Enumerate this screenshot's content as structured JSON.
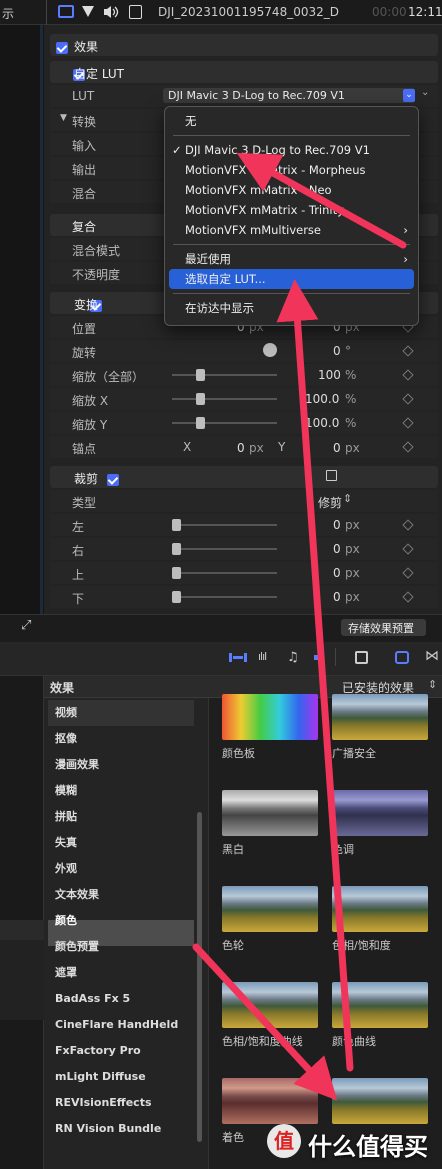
{
  "topbar": {
    "left_label": "示",
    "filename": "DJI_20231001195748_0032_D",
    "timecode_dim": "00:00",
    "timecode": "12:11"
  },
  "effects_header": "效果",
  "custom_lut": {
    "title": "自定 LUT",
    "lut_label": "LUT",
    "lut_value": "DJI Mavic 3 D-Log to Rec.709 V1",
    "convert_label": "转换",
    "input_label": "输入",
    "output_label": "输出",
    "mix_label": "混合"
  },
  "composite": {
    "title": "复合",
    "blend_mode": "混合模式",
    "opacity": "不透明度"
  },
  "transform": {
    "title": "变换",
    "rows": [
      {
        "label": "位置",
        "x": "0",
        "xunit": "px",
        "y": "0",
        "yunit": "px"
      },
      {
        "label": "旋转",
        "value": "0",
        "unit": "°"
      },
      {
        "label": "缩放（全部）",
        "value": "100",
        "unit": "%"
      },
      {
        "label": "缩放 X",
        "value": "100.0",
        "unit": "%"
      },
      {
        "label": "缩放 Y",
        "value": "100.0",
        "unit": "%"
      },
      {
        "label": "锚点",
        "xl": "X",
        "x": "0",
        "xunit": "px",
        "yl": "Y",
        "y": "0",
        "yunit": "px"
      }
    ]
  },
  "crop": {
    "title": "裁剪",
    "type_label": "类型",
    "type_value": "修剪",
    "rows": [
      {
        "label": "左",
        "value": "0",
        "unit": "px"
      },
      {
        "label": "右",
        "value": "0",
        "unit": "px"
      },
      {
        "label": "上",
        "value": "0",
        "unit": "px"
      },
      {
        "label": "下",
        "value": "0",
        "unit": "px"
      }
    ]
  },
  "save_preset": "存储效果预置",
  "lut_menu": {
    "items": [
      "无",
      "DJI Mavic 3 D-Log to Rec.709 V1",
      "MotionVFX mMatrix - Morpheus",
      "MotionVFX mMatrix - Neo",
      "MotionVFX mMatrix - Trinity",
      "MotionVFX mMultiverse",
      "最近使用",
      "选取自定 LUT...",
      "在访达中显示"
    ],
    "checked_index": 1,
    "highlight_index": 7
  },
  "browser": {
    "left_title": "效果",
    "right_title": "已安装的效果",
    "categories": [
      "视频",
      "抠像",
      "漫画效果",
      "模糊",
      "拼贴",
      "失真",
      "外观",
      "文本效果",
      "颜色",
      "颜色预置",
      "遮罩",
      "BadAss Fx 5",
      "CineFlare HandHeld",
      "FxFactory Pro",
      "mLight Diffuse",
      "REVIsionEffects",
      "RN Vision Bundle"
    ],
    "selected_category": "颜色",
    "thumbs": [
      {
        "label": "颜色板",
        "style": "rainbow"
      },
      {
        "label": "广播安全",
        "style": "landscape"
      },
      {
        "label": "黑白",
        "style": "bw"
      },
      {
        "label": "色调",
        "style": "purple"
      },
      {
        "label": "色轮",
        "style": "landscape"
      },
      {
        "label": "色相/饱和度",
        "style": "landscape"
      },
      {
        "label": "色相/饱和度曲线",
        "style": "landscape"
      },
      {
        "label": "颜色曲线",
        "style": "landscape"
      },
      {
        "label": "着色",
        "style": "red"
      },
      {
        "label": "",
        "style": "landscape"
      }
    ]
  },
  "watermark": {
    "glyph": "值",
    "text": "什么值得买"
  },
  "colors": {
    "accent": "#4a6cf7",
    "arrow": "#f0345a",
    "highlight": "#2860d8"
  }
}
